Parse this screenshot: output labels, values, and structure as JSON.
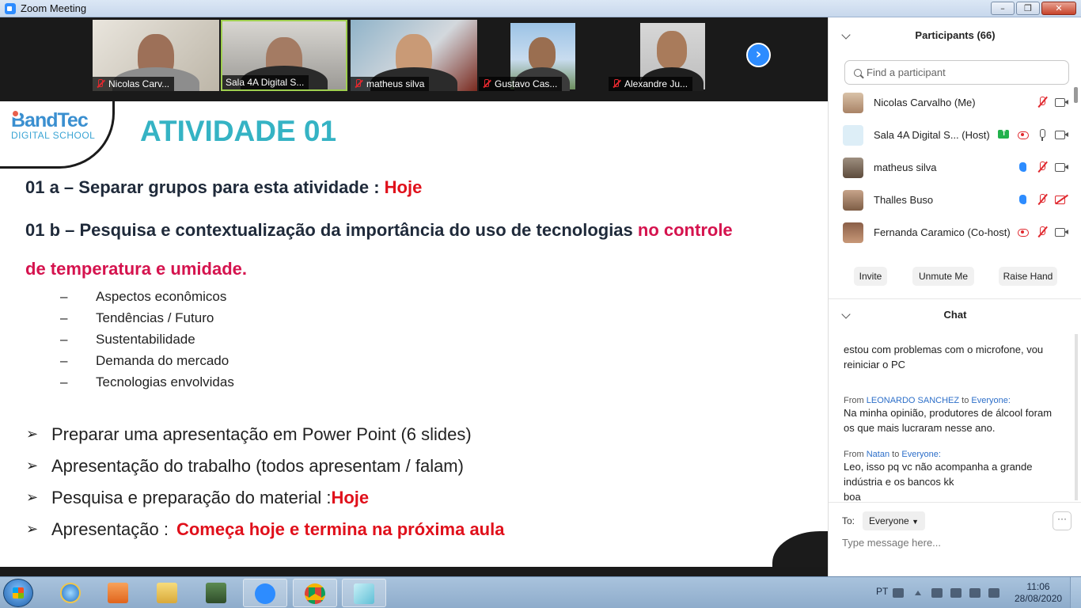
{
  "window": {
    "title": "Zoom Meeting"
  },
  "video_strip": {
    "tiles": [
      {
        "name": "Nicolas Carv...",
        "muted": true
      },
      {
        "name": "Sala 4A Digital S...",
        "muted": false,
        "active": true
      },
      {
        "name": "matheus silva",
        "muted": true
      },
      {
        "name": "Gustavo Cas...",
        "muted": true
      },
      {
        "name": "Alexandre Ju...",
        "muted": true
      }
    ]
  },
  "slide": {
    "logo_main": "BandTec",
    "logo_sub": "DIGITAL SCHOOL",
    "title": "ATIVIDADE 01",
    "item_a": {
      "label": "01  a  – Separar grupos para esta atividade : ",
      "highlight": "Hoje"
    },
    "item_b": {
      "label": "01 b – Pesquisa e contextualização da importância do uso de tecnologias ",
      "highlight": "no controle",
      "continuation": "de temperatura e umidade."
    },
    "dash_items": [
      "Aspectos econômicos",
      "Tendências / Futuro",
      "Sustentabilidade",
      "Demanda do mercado",
      "Tecnologias envolvidas"
    ],
    "arrow_items": [
      {
        "text": "Preparar uma apresentação em Power Point (6 slides)",
        "highlight": ""
      },
      {
        "text": "Apresentação do trabalho (todos apresentam / falam)",
        "highlight": ""
      },
      {
        "text": "Pesquisa e preparação do material : ",
        "highlight": "Hoje"
      },
      {
        "text": "Apresentação : ",
        "highlight": "Começa hoje e termina na próxima aula"
      }
    ]
  },
  "participants": {
    "title": "Participants (66)",
    "search_placeholder": "Find a participant",
    "list": [
      {
        "name": "Nicolas Carvalho (Me)",
        "icons": [
          "mic-off",
          "cam"
        ]
      },
      {
        "name": "Sala 4A Digital S...  (Host)",
        "icons": [
          "share",
          "rec",
          "mic-on",
          "cam"
        ]
      },
      {
        "name": "matheus silva",
        "icons": [
          "hand",
          "mic-off",
          "cam"
        ]
      },
      {
        "name": "Thalles Buso",
        "icons": [
          "hand",
          "mic-off",
          "cam-off"
        ]
      },
      {
        "name": "Fernanda Caramico (Co-host)",
        "icons": [
          "rec",
          "mic-off",
          "cam"
        ]
      }
    ],
    "buttons": {
      "invite": "Invite",
      "unmute": "Unmute Me",
      "raise_hand": "Raise Hand"
    }
  },
  "chat": {
    "title": "Chat",
    "messages": [
      {
        "from": "",
        "to": "",
        "text": "estou com problemas com o microfone, vou reiniciar o PC"
      },
      {
        "from": "LEONARDO SANCHEZ",
        "to": "Everyone:",
        "text": "Na minha opinião, produtores de álcool foram os que mais lucraram nesse ano."
      },
      {
        "from": "Natan",
        "to": "Everyone:",
        "text": "Leo, isso pq vc não acompanha a grande indústria e os bancos kk\nboa"
      }
    ],
    "from_word": "From",
    "to_word": "to",
    "to_label": "To:",
    "to_value": "Everyone",
    "more": "···",
    "input_placeholder": "Type message here..."
  },
  "taskbar": {
    "language": "PT",
    "time": "11:06",
    "date": "28/08/2020"
  }
}
